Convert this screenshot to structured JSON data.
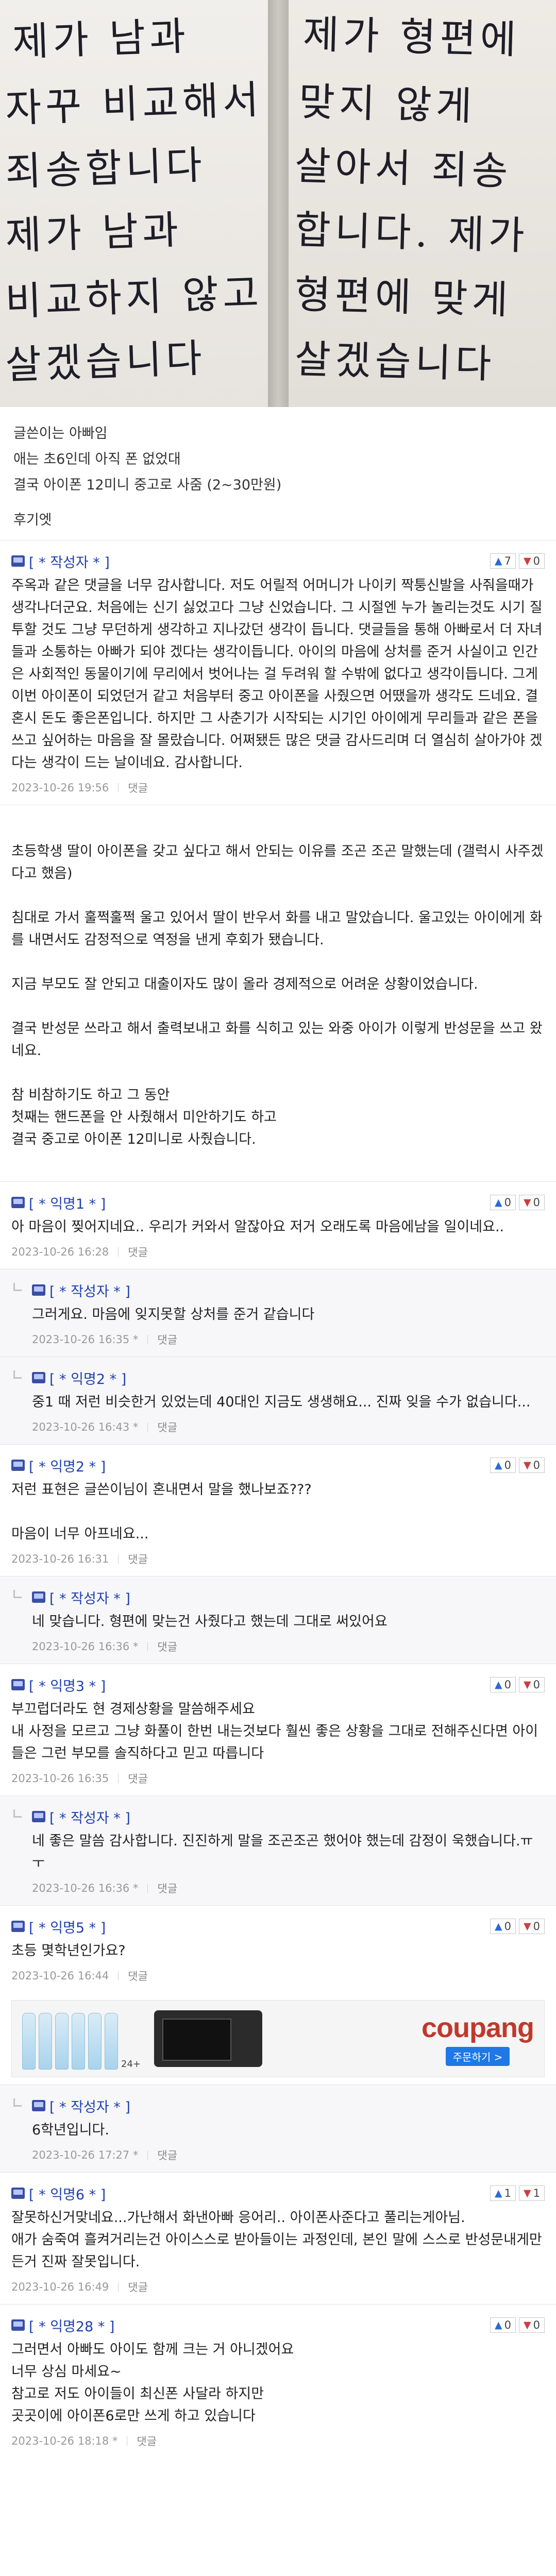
{
  "photo": {
    "left_lines": [
      "제가 남과",
      "자꾸 비교해서",
      "죄송합니다",
      "제가 남과",
      "비교하지 않고",
      "살겠습니다"
    ],
    "right_lines": [
      "제가 형편에",
      "맞지 않게",
      "살아서 죄송",
      "합니다. 제가",
      "형편에 맞게",
      "살겠습니다"
    ]
  },
  "intro": {
    "lines": [
      "글쓴이는 아빠임",
      "애는 초6인데 아직 폰 없었대",
      "결국 아이폰 12미니 중고로 사줌 (2~30만원)"
    ],
    "later": "후기엣"
  },
  "comments": [
    {
      "kind": "author",
      "reply": false,
      "nick": "[ * 작성자 * ]",
      "good": "7",
      "bad": "0",
      "body": "주옥과 같은 댓글을 너무 감사합니다. 저도 어릴적 어머니가 나이키 짝퉁신발을 사줘을때가 생각나더군요. 처음에는 신기 싫었고다 그냥 신었습니다. 그 시절엔 누가 놀리는것도 시기 질투할 것도 그냥 무던하게 생각하고 지나갔던 생각이 듭니다. 댓글들을 통해 아빠로서 더 자녀들과 소통하는 아빠가 되야 겠다는 생각이듭니다. 아이의 마음에 상처를 준거 사실이고 인간은 사회적인 동물이기에 무리에서 벗어나는 걸 두려워 할 수밖에 없다고 생각이듭니다. 그게 이번 아이폰이 되었던거 같고 처음부터 중고 아이폰을 사줬으면 어땠을까 생각도 드네요. 결혼시 돈도 좋은폰입니다. 하지만 그 사춘기가 시작되는 시기인 아이에게 무리들과 같은 폰을 쓰고 싶어하는 마음을 잘 몰랐습니다. 어쩌됐든 많은 댓글 감사드리며 더 열심히 살아가야 겠다는 생각이 드는 날이네요. 감사합니다.",
      "date": "2023-10-26 19:56",
      "reply_label": "댓글"
    },
    {
      "kind": "notice",
      "reply": false,
      "body": "초등학생 딸이 아이폰을 갖고 싶다고 해서 안되는 이유를 조곤 조곤 말했는데 (갤럭시 사주겠다고 했음)\n\n침대로 가서 훌쩍훌쩍 울고 있어서 딸이 반우서 화를 내고 말았습니다. 울고있는 아이에게 화를 내면서도 감정적으로 역정을 낸게 후회가 됐습니다.\n\n지금 부모도 잘 안되고 대출이자도 많이 올라 경제적으로 어려운 상황이었습니다.\n\n결국 반성문 쓰라고 해서 출력보내고 화를 식히고 있는 와중 아이가 이렇게 반성문을 쓰고 왔네요.\n\n참 비참하기도 하고 그 동안\n첫째는 핸드폰을 안 사줬해서 미안하기도 하고\n결국 중고로 아이폰 12미니로 사줬습니다."
    },
    {
      "kind": "anon",
      "reply": false,
      "nick": "[ * 익명1 * ]",
      "good": "0",
      "bad": "0",
      "body": "아 마음이 찢어지네요.. 우리가 커와서 알잖아요 저거 오래도록 마음에남을 일이네요..",
      "date": "2023-10-26 16:28",
      "reply_label": "댓글"
    },
    {
      "kind": "author",
      "reply": true,
      "nick": "[ * 작성자 * ]",
      "body": "그러게요. 마음에 잊지못할 상처를 준거 같습니다",
      "date": "2023-10-26 16:35 *",
      "reply_label": "댓글"
    },
    {
      "kind": "anon",
      "reply": true,
      "nick": "[ * 익명2 * ]",
      "body": "중1 때 저런 비슷한거 있었는데 40대인 지금도 생생해요... 진짜 잊을 수가 없습니다...",
      "date": "2023-10-26 16:43 *",
      "reply_label": "댓글"
    },
    {
      "kind": "anon",
      "reply": false,
      "nick": "[ * 익명2 * ]",
      "good": "0",
      "bad": "0",
      "body": "저런 표현은 글쓴이님이 혼내면서 말을 했나보죠???\n\n마음이 너무 아프네요...",
      "date": "2023-10-26 16:31",
      "reply_label": "댓글"
    },
    {
      "kind": "author",
      "reply": true,
      "nick": "[ * 작성자 * ]",
      "body": "네 맞습니다. 형편에 맞는건 사줬다고 했는데 그대로 써있어요",
      "date": "2023-10-26 16:36 *",
      "reply_label": "댓글"
    },
    {
      "kind": "anon",
      "reply": false,
      "nick": "[ * 익명3 * ]",
      "good": "0",
      "bad": "0",
      "body": "부끄럽더라도 현 경제상황을 말씀해주세요\n내 사정을 모르고 그냥 화풀이 한번 내는것보다 훨씬 좋은 상황을 그대로 전해주신다면 아이들은 그런 부모를 솔직하다고 믿고 따릅니다",
      "date": "2023-10-26 16:35",
      "reply_label": "댓글"
    },
    {
      "kind": "author",
      "reply": true,
      "nick": "[ * 작성자 * ]",
      "body": "네 좋은 말씀 감사합니다. 진진하게 말을 조곤조곤 했어야 했는데 감정이 욱했습니다.ㅠㅜ",
      "date": "2023-10-26 16:36 *",
      "reply_label": "댓글"
    },
    {
      "kind": "anon",
      "reply": false,
      "nick": "[ * 익명5 * ]",
      "good": "0",
      "bad": "0",
      "body": "초등 몇학년인가요?",
      "date": "2023-10-26 16:44",
      "reply_label": "댓글",
      "ad": true
    },
    {
      "kind": "author",
      "reply": true,
      "nick": "[ * 작성자 * ]",
      "body": "6학년입니다.",
      "date": "2023-10-26 17:27 *",
      "reply_label": "댓글"
    },
    {
      "kind": "anon",
      "reply": false,
      "nick": "[ * 익명6 * ]",
      "good": "1",
      "bad": "1",
      "body": "잘못하신거맞네요...가난해서 화낸아빠 응어리.. 아이폰사준다고 풀리는게아님.\n애가 숨죽여 흘켜거리는건 아이스스로 받아들이는 과정인데, 본인 말에 스스로 반성문내게만든거 진짜 잘못입니다.",
      "date": "2023-10-26 16:49",
      "reply_label": "댓글"
    },
    {
      "kind": "anon",
      "reply": false,
      "nick": "[ * 익명28 * ]",
      "good": "0",
      "bad": "0",
      "body": "그러면서 아빠도 아이도 함께 크는 거 아니겠어요\n너무 상심 마세요~\n참고로 저도 아이들이 최신폰 사달라 하지만\n곳곳이에 아이폰6로만 쓰게 하고 있습니다",
      "date": "2023-10-26 18:18 *",
      "reply_label": "댓글"
    }
  ],
  "ad": {
    "brand": "coupang",
    "cta": "주문하기 >",
    "badge": "24+"
  },
  "icons": {
    "level": "level-icon",
    "reply_arrow": "reply-arrow-icon",
    "thumb_up": "thumb-up-icon",
    "thumb_down": "thumb-down-icon"
  }
}
